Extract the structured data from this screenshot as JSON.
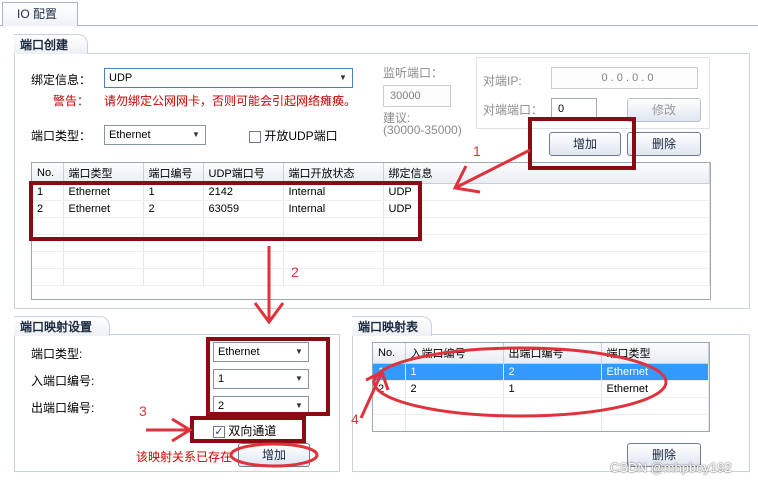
{
  "tab": {
    "label": "IO 配置"
  },
  "port_create": {
    "title": "端口创建",
    "bind_label": "绑定信息：",
    "bind_value": "UDP",
    "warning_label": "警告：",
    "warning_text": "请勿绑定公网网卡，否则可能会引起网络瘫痪。",
    "port_type_label": "端口类型：",
    "port_type_value": "Ethernet",
    "open_udp_label": "开放UDP端口",
    "open_udp_checked": false,
    "listen_label": "监听端口：",
    "listen_value": "30000",
    "suggest_label": "建议:",
    "suggest_range": "(30000-35000)",
    "remote_ip_label": "对端IP:",
    "remote_ip_value": "0  .  0  .  0  .  0",
    "remote_port_label": "对端端口：",
    "remote_port_value": "0",
    "modify_button": "修改",
    "add_button": "增加",
    "delete_button": "删除",
    "table": {
      "columns": [
        "No.",
        "端口类型",
        "端口编号",
        "UDP端口号",
        "端口开放状态",
        "绑定信息"
      ],
      "rows": [
        [
          "1",
          "Ethernet",
          "1",
          "2142",
          "Internal",
          "UDP"
        ],
        [
          "2",
          "Ethernet",
          "2",
          "63059",
          "Internal",
          "UDP"
        ]
      ]
    }
  },
  "mapping_settings": {
    "title": "端口映射设置",
    "port_type_label": "端口类型:",
    "port_type_value": "Ethernet",
    "in_port_label": "入端口编号:",
    "in_port_value": "1",
    "out_port_label": "出端口编号:",
    "out_port_value": "2",
    "bidirectional_label": "双向通道",
    "bidirectional_checked": true,
    "exists_message": "该映射关系已存在",
    "add_button": "增加"
  },
  "mapping_table": {
    "title": "端口映射表",
    "columns": [
      "No.",
      "入端口编号",
      "出端口编号",
      "端口类型"
    ],
    "rows": [
      [
        "1",
        "1",
        "2",
        "Ethernet"
      ],
      [
        "2",
        "2",
        "1",
        "Ethernet"
      ]
    ],
    "selected_row": 0,
    "delete_button": "删除"
  },
  "annotations": {
    "n1": "1",
    "n2": "2",
    "n3": "3",
    "n4": "4",
    "color": "#e0323c",
    "box_color": "#8b0a14"
  },
  "watermark": "CSDN @mhpboy192"
}
